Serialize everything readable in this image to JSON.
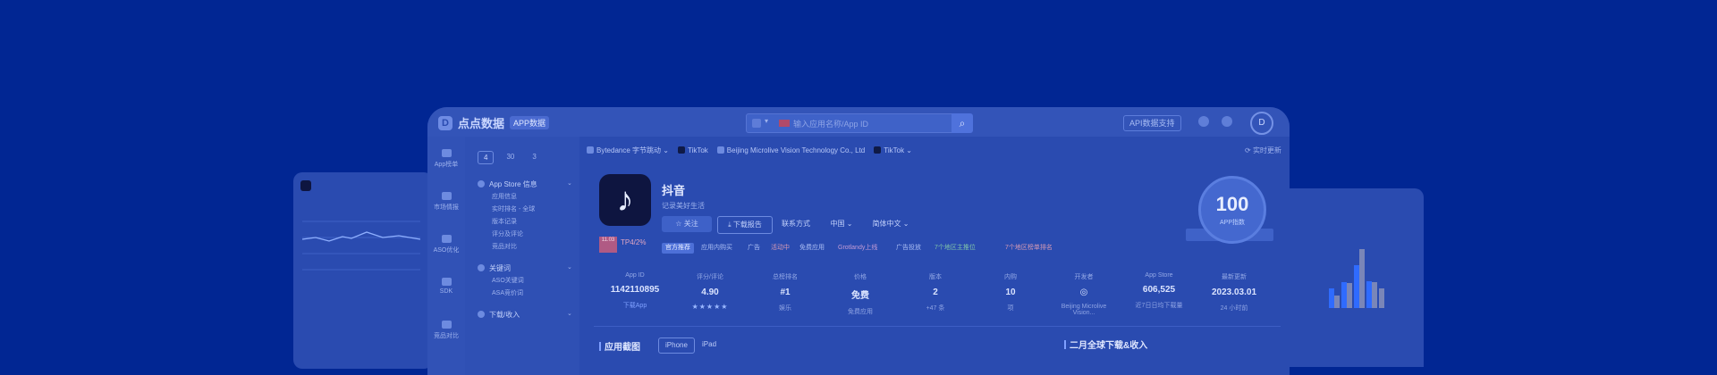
{
  "brand": {
    "name": "点点数据",
    "badge": "APP数据"
  },
  "search": {
    "placeholder": "输入应用名称/App ID"
  },
  "topbar": {
    "api_label": "API数据支持",
    "avatar": "D"
  },
  "sidebar": {
    "items": [
      {
        "label": "App榜单"
      },
      {
        "label": "市场情报"
      },
      {
        "label": "ASO优化"
      },
      {
        "label": "SDK"
      },
      {
        "label": "竞品对比"
      }
    ]
  },
  "segments": [
    {
      "label": "4"
    },
    {
      "label": "30"
    },
    {
      "label": "3"
    }
  ],
  "subnav": {
    "sections": [
      {
        "label": "App Store 信息",
        "items": [
          "应用信息",
          "实时排名 - 全球",
          "版本记录",
          "评分及评论",
          "竞品对比"
        ]
      },
      {
        "label": "关键词",
        "items": [
          "ASO关键词",
          "ASA竞价词"
        ]
      },
      {
        "label": "下载/收入"
      }
    ]
  },
  "breadcrumbs": [
    "Bytedance 字节跳动",
    "TikTok",
    "Beijing Microlive Vision Technology Co., Ltd",
    "TikTok"
  ],
  "refresh_label": "实时更新",
  "app": {
    "name": "抖音",
    "subtitle": "记录美好生活",
    "icon_glyph": "♪",
    "buttons": {
      "follow": "关注",
      "download": "下载报告",
      "contact": "联系方式",
      "country": "中国",
      "language": "简体中文"
    },
    "rank_badge": "11.03",
    "top_tag": "TP4/2%",
    "tags": [
      "官方推荐",
      "应用内购买",
      "广告",
      "活动中",
      "免费应用",
      "Grotlandy上线",
      "广告投放",
      "7个地区主推位",
      "7个地区榜单排名"
    ],
    "score": {
      "value": "100",
      "label": "APP指数"
    }
  },
  "stats": [
    {
      "header": "App ID",
      "value": "1142110895",
      "sub": "下载App"
    },
    {
      "header": "评分/评论",
      "value": "4.90",
      "sub": "★★★★★"
    },
    {
      "header": "总榜排名",
      "value": "#1",
      "sub": "娱乐"
    },
    {
      "header": "价格",
      "value": "免费",
      "sub": "免费应用"
    },
    {
      "header": "版本",
      "value": "2",
      "sub": "+47 条"
    },
    {
      "header": "内购",
      "value": "10",
      "sub": "项"
    },
    {
      "header": "开发者",
      "value": "",
      "sub": "Beijing Microlive Vision..."
    },
    {
      "header": "App Store",
      "value": "606,525",
      "sub": "近7日日均下载量"
    },
    {
      "header": "最新更新",
      "value": "2023.03.01",
      "sub": "24 小时前"
    }
  ],
  "sections": {
    "screenshots": "应用截图",
    "downloads": "二月全球下载&收入",
    "tabs": [
      "iPhone",
      "iPad"
    ]
  }
}
